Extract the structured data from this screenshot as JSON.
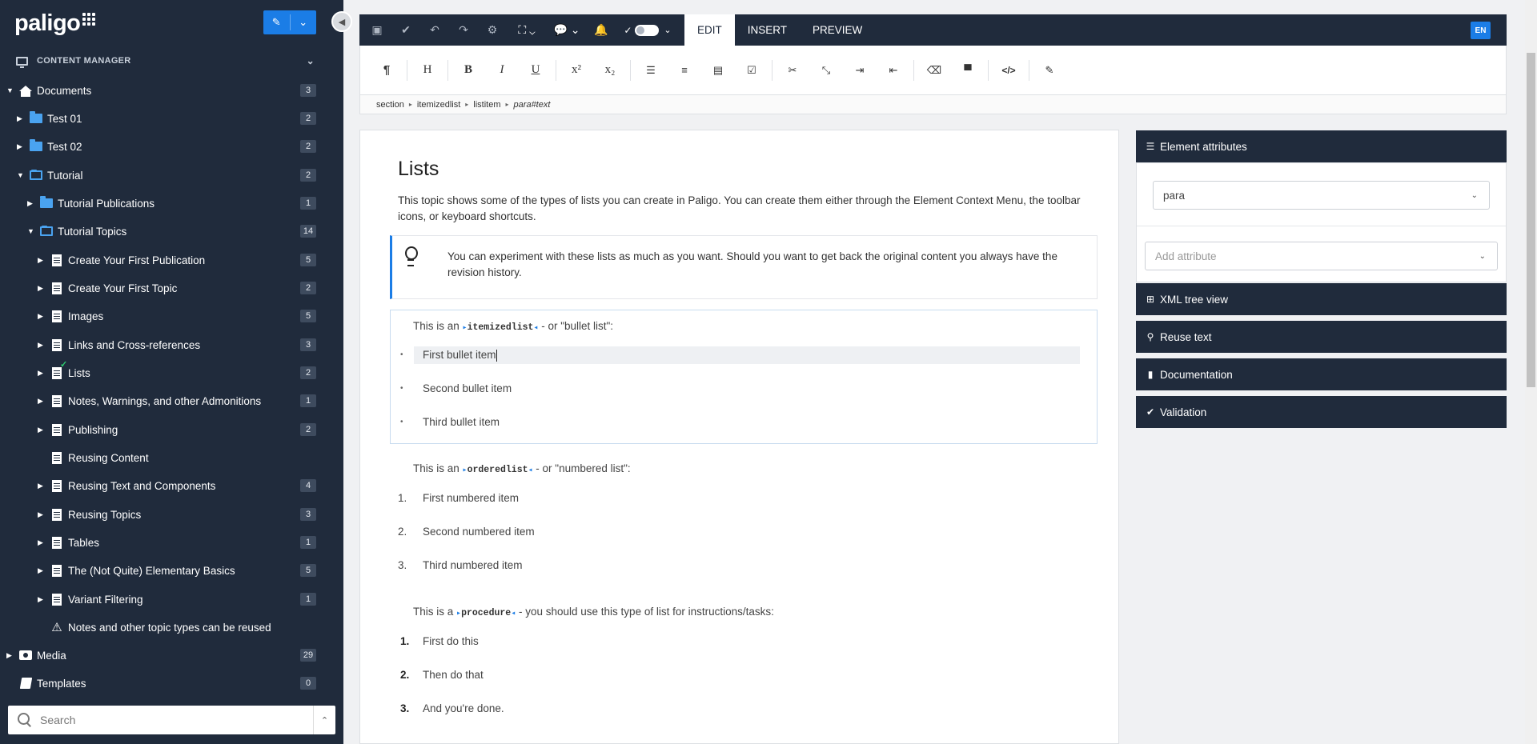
{
  "sidebar": {
    "logo": "paligo",
    "section_title": "CONTENT MANAGER",
    "tree": [
      {
        "label": "Documents",
        "count": "3"
      },
      {
        "label": "Test 01",
        "count": "2"
      },
      {
        "label": "Test 02",
        "count": "2"
      },
      {
        "label": "Tutorial",
        "count": "2"
      },
      {
        "label": "Tutorial Publications",
        "count": "1"
      },
      {
        "label": "Tutorial Topics",
        "count": "14"
      },
      {
        "label": "Create Your First Publication",
        "count": "5"
      },
      {
        "label": "Create Your First Topic",
        "count": "2"
      },
      {
        "label": "Images",
        "count": "5"
      },
      {
        "label": "Links and Cross-references",
        "count": "3"
      },
      {
        "label": "Lists",
        "count": "2"
      },
      {
        "label": "Notes, Warnings, and other Admonitions",
        "count": "1"
      },
      {
        "label": "Publishing",
        "count": "2"
      },
      {
        "label": "Reusing Content",
        "count": ""
      },
      {
        "label": "Reusing Text and Components",
        "count": "4"
      },
      {
        "label": "Reusing Topics",
        "count": "3"
      },
      {
        "label": "Tables",
        "count": "1"
      },
      {
        "label": "The (Not Quite) Elementary Basics",
        "count": "5"
      },
      {
        "label": "Variant Filtering",
        "count": "1"
      },
      {
        "label": "Notes and other topic types can be reused",
        "count": ""
      },
      {
        "label": "Media",
        "count": "29"
      },
      {
        "label": "Templates",
        "count": "0"
      }
    ],
    "search_placeholder": "Search"
  },
  "toolbar": {
    "tabs": [
      "EDIT",
      "INSERT",
      "PREVIEW"
    ],
    "language": "EN"
  },
  "format_bar": {
    "heading": "H",
    "bold": "B",
    "italic": "I",
    "underline": "U",
    "superscript": "x²",
    "subscript": "x₂"
  },
  "breadcrumb": [
    "section",
    "itemizedlist",
    "listitem",
    "para#text"
  ],
  "editor": {
    "title": "Lists",
    "intro": "This topic shows some of the types of lists you can create in Paligo. You can create them either through the Element Context Menu, the toolbar icons, or keyboard shortcuts.",
    "note": "You can experiment with these lists as much as you want. Should you want to get back the original content you always have the revision history.",
    "bullet_intro_pre": "This is an",
    "bullet_tag": "itemizedlist",
    "bullet_intro_post": "- or \"bullet list\":",
    "bullets": [
      "First bullet item",
      "Second bullet item",
      "Third bullet item"
    ],
    "ordered_intro_pre": "This is an",
    "ordered_tag": "orderedlist",
    "ordered_intro_post": "- or \"numbered list\":",
    "ordered": [
      "First numbered item",
      "Second numbered item",
      "Third numbered item"
    ],
    "ordered_nums": [
      "1.",
      "2.",
      "3."
    ],
    "procedure_intro_pre": "This is a",
    "procedure_tag": "procedure",
    "procedure_intro_post": "- you should use this type of list for instructions/tasks:",
    "steps": [
      "First do this",
      "Then do that",
      "And you're done."
    ],
    "step_nums": [
      "1.",
      "2.",
      "3."
    ]
  },
  "right_panel": {
    "element_attributes": "Element attributes",
    "element_value": "para",
    "add_attribute_placeholder": "Add attribute",
    "xml_tree": "XML tree view",
    "reuse_text": "Reuse text",
    "documentation": "Documentation",
    "validation": "Validation"
  }
}
